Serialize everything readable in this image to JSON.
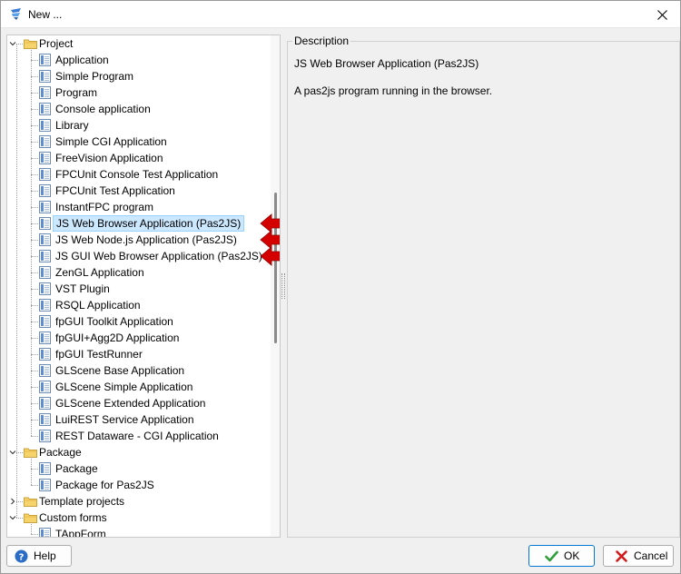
{
  "window": {
    "title": "New ...",
    "app_icon": "lazarus-icon"
  },
  "tree": {
    "groups": [
      {
        "label": "Project",
        "expanded": true,
        "items": [
          "Application",
          "Simple Program",
          "Program",
          "Console application",
          "Library",
          "Simple CGI Application",
          "FreeVision Application",
          "FPCUnit Console Test Application",
          "FPCUnit Test Application",
          "InstantFPC program",
          "JS Web Browser Application (Pas2JS)",
          "JS Web Node.js Application (Pas2JS)",
          "JS GUI Web Browser Application (Pas2JS)",
          "ZenGL Application",
          "VST Plugin",
          "RSQL Application",
          "fpGUI Toolkit Application",
          "fpGUI+Agg2D Application",
          "fpGUI TestRunner",
          "GLScene Base Application",
          "GLScene Simple Application",
          "GLScene Extended Application",
          "LuiREST Service Application",
          "REST Dataware - CGI Application"
        ]
      },
      {
        "label": "Package",
        "expanded": true,
        "items": [
          "Package",
          "Package for Pas2JS"
        ]
      },
      {
        "label": "Template projects",
        "expanded": false,
        "items": []
      },
      {
        "label": "Custom forms",
        "expanded": true,
        "items": [
          "TAppForm"
        ]
      }
    ],
    "selected_item": "JS Web Browser Application (Pas2JS)",
    "highlighted_items": [
      "JS Web Browser Application (Pas2JS)",
      "JS Web Node.js Application (Pas2JS)",
      "JS GUI Web Browser Application (Pas2JS)"
    ],
    "selection_color": "#cce8ff"
  },
  "description": {
    "legend": "Description",
    "title": "JS Web Browser Application (Pas2JS)",
    "text": "A pas2js program running in the browser."
  },
  "buttons": {
    "help": "Help",
    "ok": "OK",
    "cancel": "Cancel"
  },
  "annotation": {
    "arrow_color": "#d40000",
    "arrow_icon": "red-arrow-left-icon"
  }
}
